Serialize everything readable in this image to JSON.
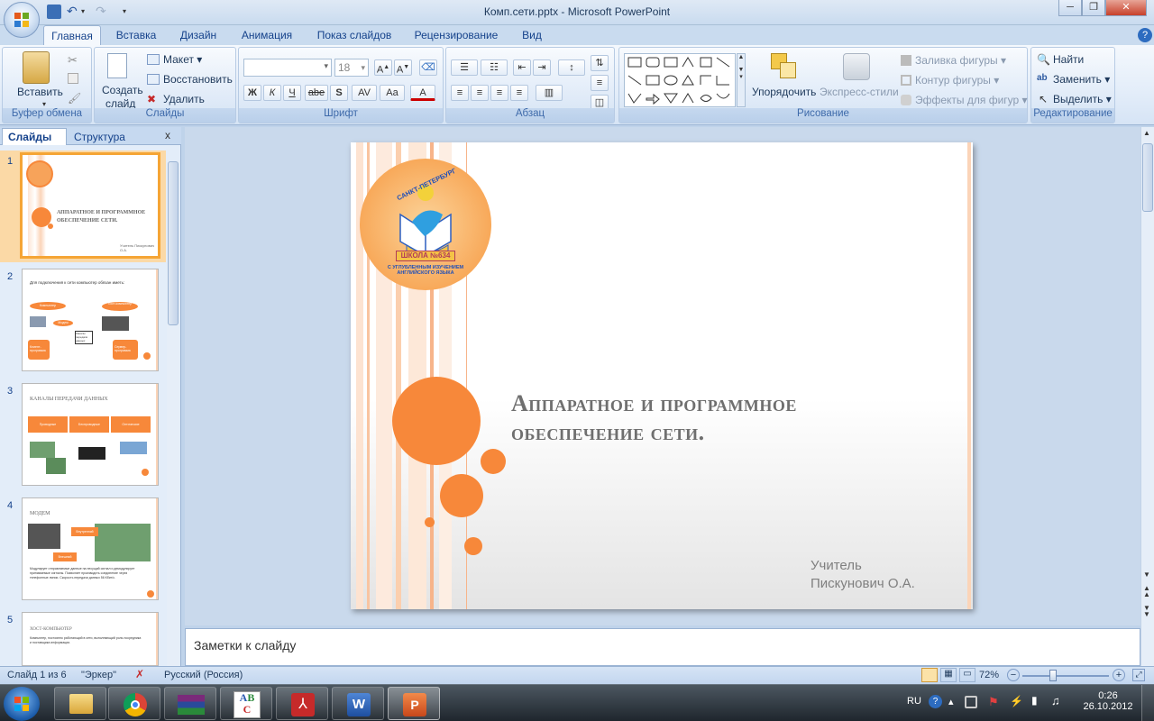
{
  "window": {
    "title": "Комп.сети.pptx - Microsoft PowerPoint"
  },
  "tabs": [
    {
      "label": "Главная",
      "active": true
    },
    {
      "label": "Вставка"
    },
    {
      "label": "Дизайн"
    },
    {
      "label": "Анимация"
    },
    {
      "label": "Показ слайдов"
    },
    {
      "label": "Рецензирование"
    },
    {
      "label": "Вид"
    }
  ],
  "ribbon": {
    "clipboard": {
      "label": "Буфер обмена",
      "paste": "Вставить"
    },
    "slides": {
      "label": "Слайды",
      "create": "Создать",
      "create2": "слайд",
      "layout": "Макет",
      "reset": "Восстановить",
      "delete": "Удалить"
    },
    "font": {
      "label": "Шрифт",
      "size": "18",
      "bold": "Ж",
      "italic": "К",
      "underline": "Ч",
      "strike": "abe",
      "shadow": "S",
      "spacing": "AV",
      "case": "Aa",
      "color": "A"
    },
    "paragraph": {
      "label": "Абзац"
    },
    "drawing": {
      "label": "Рисование",
      "arrange": "Упорядочить",
      "quick_styles": "Экспресс-стили",
      "fill": "Заливка фигуры",
      "outline": "Контур фигуры",
      "effects": "Эффекты для фигур"
    },
    "editing": {
      "label": "Редактирование",
      "find": "Найти",
      "replace": "Заменить",
      "select": "Выделить"
    }
  },
  "leftpane": {
    "tab_slides": "Слайды",
    "tab_outline": "Структура",
    "close": "x",
    "thumbnails": [
      {
        "num": "1",
        "title": "Аппаратное и программное обеспечение сети.",
        "footer": "Учитель Пискунович О.А."
      },
      {
        "num": "2",
        "title": "Для подключения к сети компьютер обязан иметь:",
        "labels": [
          "Компьютер",
          "Хост-компьютер",
          "Модем",
          "Каналы передачи данных",
          "Клиент-программа",
          "Сервер-программа"
        ]
      },
      {
        "num": "3",
        "title": "Каналы передачи данных",
        "labels": [
          "Проводные",
          "Беспроводные",
          "Оптические"
        ]
      },
      {
        "num": "4",
        "title": "Модем",
        "labels": [
          "Внутренний",
          "Внешний"
        ],
        "text": "Модулирует отправляемые данные на несущий сигнал и демодулирует принимаемые сигналы. Позволяет производить соединение через телефонные линии. Скорость передачи данных 56 Кбит/с."
      },
      {
        "num": "5",
        "title": "Хост-компьютер",
        "text": "Компьютер, постоянно работающий в сети, выполняющий роль посредника и поставщика информации."
      }
    ]
  },
  "slide": {
    "logo_top": "САНКТ-ПЕТЕРБУРГ",
    "logo_school": "ШКОЛА №634",
    "logo_bottom": "С УГЛУБЛЕННЫМ ИЗУЧЕНИЕМ АНГЛИЙСКОГО ЯЗЫКА",
    "title_line1": "Аппаратное и программное",
    "title_line2": "обеспечение сети.",
    "author_line1": "Учитель",
    "author_line2": "Пискунович О.А."
  },
  "notes": {
    "placeholder": "Заметки к слайду"
  },
  "status": {
    "slide": "Слайд 1 из 6",
    "theme": "\"Эркер\"",
    "language": "Русский (Россия)",
    "zoom": "72%"
  },
  "taskbar": {
    "lang": "RU",
    "time": "0:26",
    "date": "26.10.2012"
  },
  "colors": {
    "accent_orange": "#f7883a",
    "ribbon_blue": "#15428b",
    "title_gray": "#7f7f7f"
  }
}
